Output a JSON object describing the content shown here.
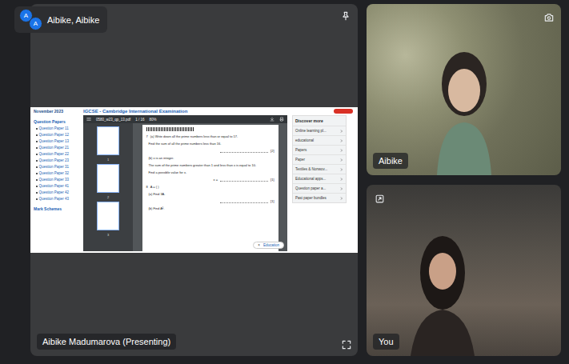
{
  "participants_chip": {
    "avatars": [
      "A",
      "A"
    ],
    "label": "Aibike, Aibike"
  },
  "presenter_tile": {
    "label": "Aibike Madumarova (Presenting)"
  },
  "shared_screen": {
    "sidebar": {
      "top": "November 2023",
      "heading": "Question Papers",
      "items": [
        "Question Paper 11",
        "Question Paper 12",
        "Question Paper 13",
        "Question Paper 21",
        "Question Paper 22",
        "Question Paper 23",
        "Question Paper 31",
        "Question Paper 32",
        "Question Paper 33",
        "Question Paper 41",
        "Question Paper 42",
        "Question Paper 43"
      ],
      "footer": "Mark Schemes"
    },
    "site_title": "IGCSE - Cambridge International Examination",
    "viewer": {
      "filename": "0580_w23_qp_13.pdf",
      "page": "1 / 16",
      "zoom": "80%",
      "thumbnails": [
        "1",
        "2",
        "3"
      ],
      "lines": [
        {
          "num": "7",
          "text": "(a) Write down all the prime numbers less than or equal to 17."
        },
        {
          "num": "",
          "text": "Find the sum of all the prime numbers less than 16."
        },
        {
          "num": "",
          "text": "(b) x is an integer."
        },
        {
          "num": "",
          "text": "The sum of the prime numbers greater than 1 and less than x is equal to 10."
        },
        {
          "num": "",
          "text": "Find a possible value for x."
        },
        {
          "num": "8",
          "text": "A = ( )"
        },
        {
          "num": "",
          "text": "(a) Find 3A."
        },
        {
          "num": "",
          "text": "(b) Find A²."
        }
      ],
      "marks": [
        "[2]",
        "x = ",
        "[1]",
        "[1]"
      ],
      "chip": {
        "close": "×",
        "label": "Education"
      }
    },
    "discover": {
      "heading": "Discover more",
      "items": [
        "Online learning pl...",
        "educational",
        "Papers",
        "Paper",
        "Textiles & Nonwov...",
        "Educational apps...",
        "Question paper a...",
        "Past paper bundles"
      ]
    }
  },
  "tiles": [
    {
      "label": "Aibike"
    },
    {
      "label": "You"
    }
  ]
}
